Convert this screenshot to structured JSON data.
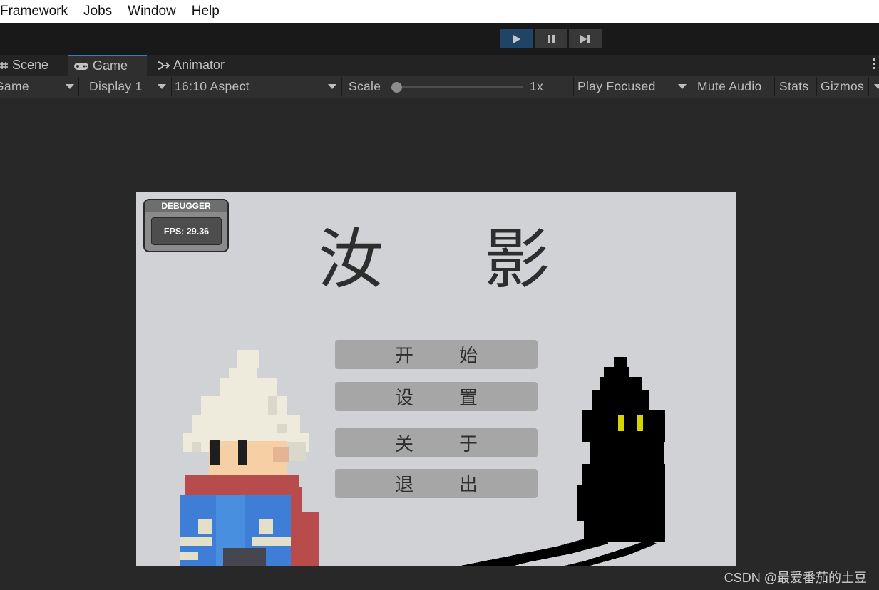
{
  "menubar": {
    "items": [
      "Framework",
      "Jobs",
      "Window",
      "Help"
    ]
  },
  "playcontrols": {
    "play": {
      "icon": "play-icon",
      "active": true
    },
    "pause": {
      "icon": "pause-icon",
      "active": false
    },
    "step": {
      "icon": "step-icon",
      "active": false
    }
  },
  "tabs": [
    {
      "label": "Scene",
      "icon": "scene-grid-icon",
      "active": false
    },
    {
      "label": "Game",
      "icon": "gamepad-icon",
      "active": true
    },
    {
      "label": "Animator",
      "icon": "animator-icon",
      "active": false
    }
  ],
  "gamebar": {
    "view_mode": "Game",
    "display": "Display 1",
    "aspect": "16:10 Aspect",
    "scale_label": "Scale",
    "scale_value": "1x",
    "scale_fraction": 0,
    "play_mode": "Play Focused",
    "mute_audio": "Mute Audio",
    "stats": "Stats",
    "gizmos": "Gizmos"
  },
  "game": {
    "debugger": {
      "title": "DEBUGGER",
      "fps": "FPS: 29.36"
    },
    "title_chars": [
      "汝",
      "影"
    ],
    "buttons": [
      {
        "chars": [
          "开",
          "始"
        ]
      },
      {
        "chars": [
          "设",
          "置"
        ]
      },
      {
        "chars": [
          "关",
          "于"
        ]
      },
      {
        "chars": [
          "退",
          "出"
        ]
      }
    ],
    "colors": {
      "background": "#d1d2d6",
      "button": "#a6a6a6",
      "title_text": "#2e2e2e",
      "shadow_eyes": "#d4d400"
    }
  },
  "watermark": "CSDN @最爱番茄的土豆"
}
